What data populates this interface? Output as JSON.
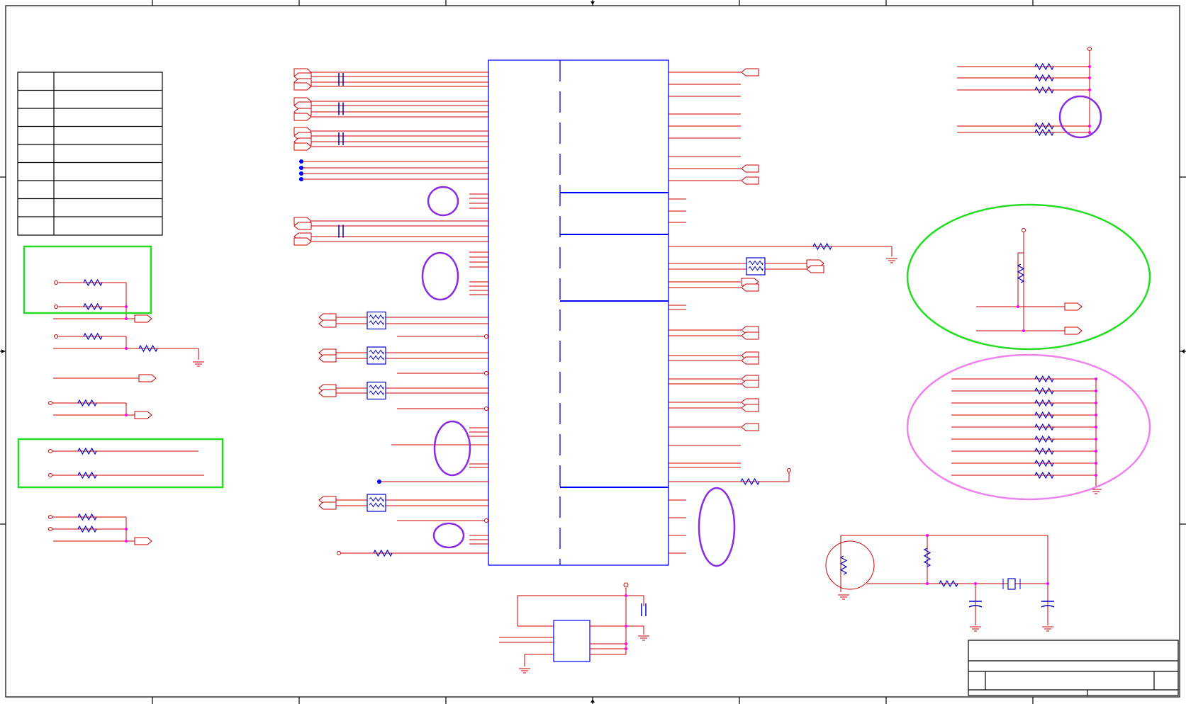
{
  "title_block": {
    "title": "",
    "document_number": "",
    "revision": "",
    "sheet": ""
  },
  "strap_table": {
    "rows": [
      [
        "",
        ""
      ],
      [
        "",
        ""
      ],
      [
        "",
        ""
      ],
      [
        "",
        ""
      ],
      [
        "",
        ""
      ],
      [
        "",
        ""
      ],
      [
        "",
        ""
      ],
      [
        "",
        ""
      ],
      [
        "",
        ""
      ]
    ]
  },
  "colors": {
    "border": "#000000",
    "wire": "#cc0000",
    "component": "#0000cc",
    "ic_outline": "#0000ff",
    "junction": "#ff00ff",
    "connector_dot": "#0000ff",
    "highlight_purple": "#8a2be2",
    "highlight_green": "#22dd22",
    "highlight_pink": "#ee82ee"
  },
  "icons": {
    "resistor": "zigzag-resistor-icon",
    "capacitor": "capacitor-icon",
    "ground": "ground-icon",
    "crystal": "crystal-icon",
    "offpage_connector": "offpage-connector-icon",
    "ferrite": "ferrite-bead-icon"
  }
}
